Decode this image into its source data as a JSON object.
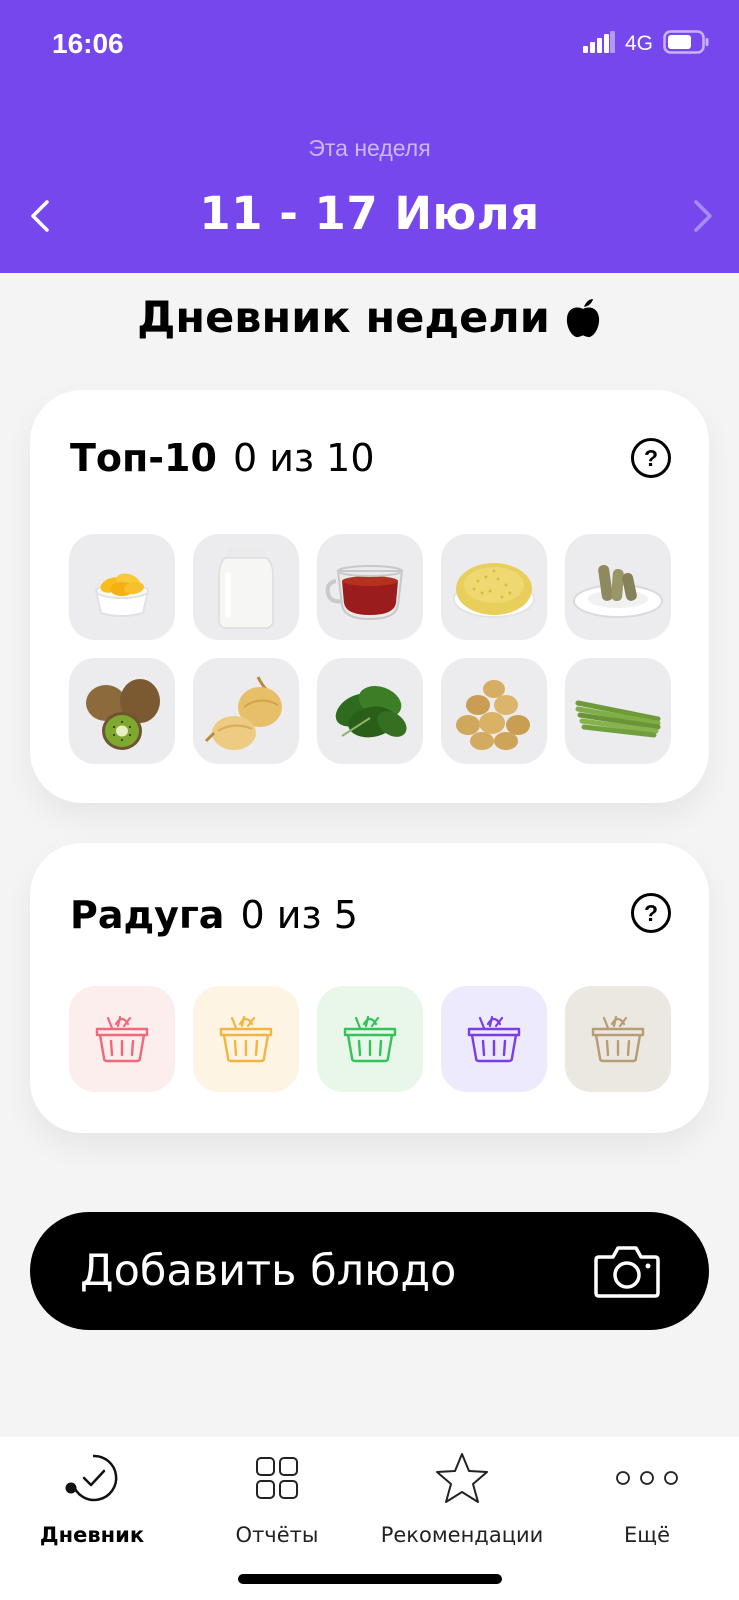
{
  "status": {
    "time": "16:06",
    "network": "4G"
  },
  "header": {
    "week_label": "Эта неделя",
    "range": "11 - 17 Июля"
  },
  "page_title": "Дневник недели",
  "top10": {
    "title": "Топ-10",
    "count": "0 из 10",
    "items": [
      {
        "icon": "fish-oil-capsules-icon"
      },
      {
        "icon": "milk-jar-icon"
      },
      {
        "icon": "tea-cup-icon"
      },
      {
        "icon": "millet-bowl-icon"
      },
      {
        "icon": "asparagus-plate-icon"
      },
      {
        "icon": "kiwi-icon"
      },
      {
        "icon": "onion-icon"
      },
      {
        "icon": "spinach-icon"
      },
      {
        "icon": "potatoes-icon"
      },
      {
        "icon": "green-asparagus-icon"
      }
    ]
  },
  "rainbow": {
    "title": "Радуга",
    "count": "0 из 5",
    "baskets": [
      {
        "color": "#f0697a",
        "bg": "#fdeeee"
      },
      {
        "color": "#f2b640",
        "bg": "#fdf4e4"
      },
      {
        "color": "#33c35a",
        "bg": "#e8f7ea"
      },
      {
        "color": "#7a3dea",
        "bg": "#eeeafd"
      },
      {
        "color": "#b89c74",
        "bg": "#ebe8e2"
      }
    ]
  },
  "add_button": {
    "label": "Добавить блюдо"
  },
  "tabs": [
    {
      "label": "Дневник",
      "icon": "diary-icon",
      "active": true
    },
    {
      "label": "Отчёты",
      "icon": "reports-grid-icon",
      "active": false
    },
    {
      "label": "Рекомендации",
      "icon": "star-icon",
      "active": false
    },
    {
      "label": "Ещё",
      "icon": "more-dots-icon",
      "active": false
    }
  ]
}
